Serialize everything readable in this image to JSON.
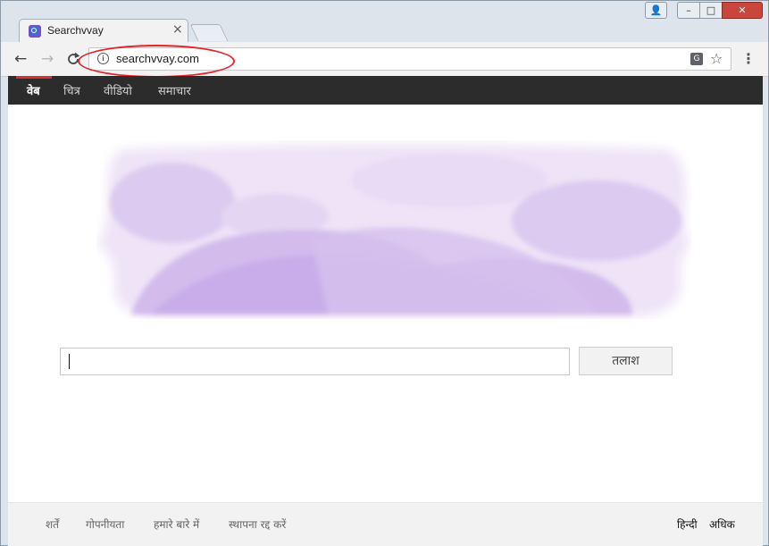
{
  "browser": {
    "tab_title": "Searchvvay",
    "tab_close": "×",
    "url": "searchvvay.com",
    "buttons": {
      "back": "←",
      "forward": "→",
      "reload": "C"
    },
    "window_controls": {
      "user": "👤",
      "minimize": "–",
      "maximize": "□",
      "close": "✕"
    },
    "icons": {
      "info": "i",
      "translate": "G",
      "star": "☆",
      "menu": "⋮"
    },
    "annotation_color": "#e0262a"
  },
  "nav": {
    "items": [
      {
        "label": "वेब",
        "active": true
      },
      {
        "label": "चित्र",
        "active": false
      },
      {
        "label": "वीडियो",
        "active": false
      },
      {
        "label": "समाचार",
        "active": false
      }
    ],
    "accent_color": "#d9302c"
  },
  "search": {
    "input_value": "",
    "button_label": "तलाश"
  },
  "footer": {
    "links": [
      "शर्तें",
      "गोपनीयता",
      "हमारे बारे में",
      "स्थापना रद्द करें"
    ],
    "language": "हिन्दी",
    "more": "अधिक"
  }
}
